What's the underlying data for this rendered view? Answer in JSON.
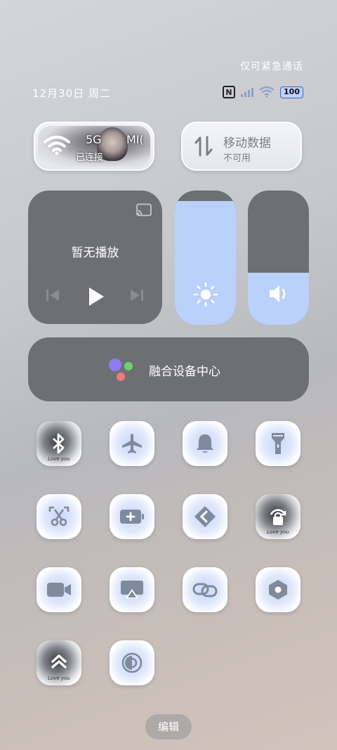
{
  "status_bar": {
    "emergency_text": "仅可紧急通话",
    "date_text": "12月30日 周二",
    "nfc_label": "N",
    "battery_level": "100"
  },
  "wifi_tile": {
    "network_fragment_1": "5G",
    "network_fragment_2": "MI(",
    "status": "已连接"
  },
  "data_tile": {
    "label": "移动数据",
    "status": "不可用"
  },
  "media": {
    "title": "暂无播放"
  },
  "brightness": {
    "level_fraction": 0.92
  },
  "volume": {
    "level_fraction": 0.39
  },
  "fusion": {
    "label": "融合设备中心",
    "dot_colors": [
      "#8f7cf0",
      "#6fd26a",
      "#f07a7a"
    ]
  },
  "tiles": [
    {
      "icon": "bluetooth-icon",
      "caption": "Love you"
    },
    {
      "icon": "airplane-icon"
    },
    {
      "icon": "bell-icon"
    },
    {
      "icon": "flashlight-icon"
    },
    {
      "icon": "screenshot-icon"
    },
    {
      "icon": "battery-saver-icon"
    },
    {
      "icon": "nearby-share-icon"
    },
    {
      "icon": "rotation-lock-icon",
      "caption": "Love you"
    },
    {
      "icon": "screen-record-icon"
    },
    {
      "icon": "screen-cast-icon"
    },
    {
      "icon": "link-icon"
    },
    {
      "icon": "settings-hex-icon"
    },
    {
      "icon": "performance-icon",
      "caption": "Love you"
    },
    {
      "icon": "dark-mode-icon"
    }
  ],
  "edit_label": "编辑",
  "colors": {
    "accent": "#b9d1fb",
    "card": "#6e6f73",
    "icon": "#7f8a9c"
  }
}
